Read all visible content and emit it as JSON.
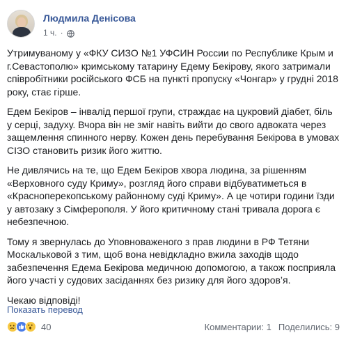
{
  "post": {
    "author": "Людмила Денісова",
    "time": "1 ч.",
    "separator": "·",
    "paragraphs": [
      "Утримуваному у «ФКУ СИЗО №1 УФСИН России по Республике Крым и г.Севастополю» кримському татарину Едему Бекірову, якого затримали співробітники російського ФСБ на пункті пропуску «Чонгар» у грудні 2018 року, стає гірше.",
      "Едем Бекіров – інвалід першої групи, страждає на цукровий діабет, біль у серці, задуху. Вчора він не зміг навіть вийти до свого адвоката через защемлення спинного нерву. Кожен день перебування Бекірова в умовах СІЗО становить ризик його життю.",
      "Не дивлячись на те, що Едем Бекіров хвора людина, за рішенням «Верховного суду Криму», розгляд його справи відбуватиметься в «Красноперекопському районному суді Криму». А це чотири години їзди у автозаку з Сімферополя. У його критичному стані тривала дорога є небезпечною.",
      "Тому я звернулась до Уповноваженого з прав людини в РФ Тетяни Москальковой з тим, щоб вона невідкладно вжила заходів щодо забезпечення Едема Бекірова медичною допомогою, а також посприяла його участі у судових засіданнях без ризику для його здоров’я.",
      "Чекаю відповіді!"
    ],
    "translate_link": "Показать перевод",
    "reactions": {
      "icons": [
        "sad-icon",
        "like-icon",
        "wow-icon"
      ],
      "count": "40"
    },
    "comments": "Комментарии: 1",
    "shares": "Поделились: 9"
  },
  "colors": {
    "link": "#385898",
    "text": "#1c1e21",
    "meta": "#616770"
  }
}
